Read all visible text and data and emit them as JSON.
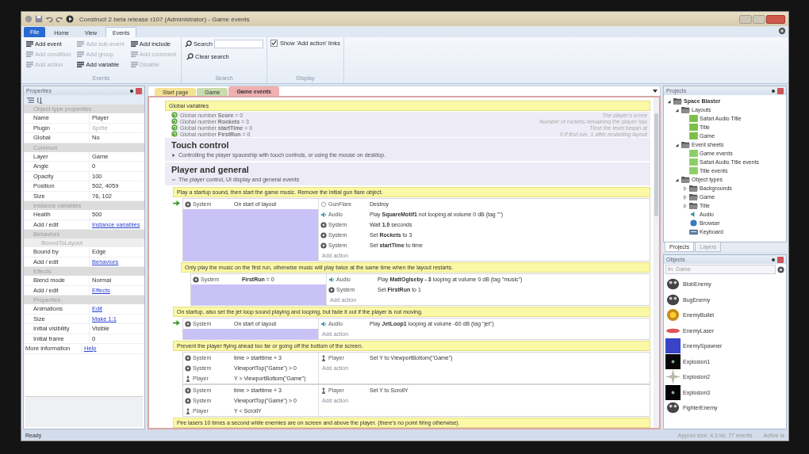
{
  "window": {
    "title": "Construct 2 beta release r107 (Administrator) - Game events"
  },
  "ribbon_tabs": [
    {
      "label": "File",
      "kind": "app"
    },
    {
      "label": "Home",
      "kind": "tab",
      "selected": false
    },
    {
      "label": "View",
      "kind": "tab",
      "selected": false
    },
    {
      "label": "Events",
      "kind": "tab",
      "selected": true
    }
  ],
  "ribbon": {
    "events_group": {
      "label": "Events",
      "buttons": [
        {
          "label": "Add event",
          "disabled": false
        },
        {
          "label": "Add condition",
          "disabled": true
        },
        {
          "label": "Add action",
          "disabled": true
        },
        {
          "label": "Add sub-event",
          "disabled": true
        },
        {
          "label": "Add group",
          "disabled": true
        },
        {
          "label": "Add variable",
          "disabled": false
        },
        {
          "label": "Add include",
          "disabled": false
        },
        {
          "label": "Add comment",
          "disabled": true
        },
        {
          "label": "Disable",
          "disabled": true
        }
      ]
    },
    "search_group": {
      "label": "Search",
      "search_label": "Search",
      "clear": "Clear search"
    },
    "display_group": {
      "label": "Display",
      "checkbox": "Show 'Add action' links",
      "checked": true
    }
  },
  "properties": {
    "title": "Properties",
    "sections": [
      {
        "title": "Object type properties",
        "rows": [
          {
            "name": "Name",
            "value": "Player",
            "kind": "value"
          },
          {
            "name": "Plugin",
            "value": "Sprite",
            "kind": "readonly"
          },
          {
            "name": "Global",
            "value": "No",
            "kind": "value"
          }
        ]
      },
      {
        "title": "Common",
        "rows": [
          {
            "name": "Layer",
            "value": "Game",
            "kind": "value"
          },
          {
            "name": "Angle",
            "value": "0",
            "kind": "value"
          },
          {
            "name": "Opacity",
            "value": "100",
            "kind": "value"
          },
          {
            "name": "Position",
            "value": "502, 4059",
            "kind": "value"
          },
          {
            "name": "Size",
            "value": "76, 102",
            "kind": "value"
          }
        ]
      },
      {
        "title": "Instance variables",
        "rows": [
          {
            "name": "Health",
            "value": "500",
            "kind": "value"
          },
          {
            "name": "Add / edit",
            "value": "Instance variables",
            "kind": "link"
          }
        ]
      },
      {
        "title": "Behaviors",
        "rows": [
          {
            "name": "BoundToLayout",
            "kind": "subheading"
          },
          {
            "name": "Bound by",
            "value": "Edge",
            "kind": "value"
          },
          {
            "name": "Add / edit",
            "value": "Behaviors",
            "kind": "link"
          }
        ]
      },
      {
        "title": "Effects",
        "rows": [
          {
            "name": "Blend mode",
            "value": "Normal",
            "kind": "value"
          },
          {
            "name": "Add / edit",
            "value": "Effects",
            "kind": "link"
          }
        ]
      },
      {
        "title": "Properties",
        "rows": [
          {
            "name": "Animations",
            "value": "Edit",
            "kind": "link"
          },
          {
            "name": "Size",
            "value": "Make 1:1",
            "kind": "link"
          },
          {
            "name": "Initial visibility",
            "value": "Visible",
            "kind": "value"
          },
          {
            "name": "Initial frame",
            "value": "0",
            "kind": "value"
          }
        ]
      }
    ],
    "footer_row": {
      "name": "More information",
      "value": "Help"
    }
  },
  "document_tabs": [
    {
      "label": "Start page",
      "color": "#f5e394",
      "selected": false
    },
    {
      "label": "Game",
      "color": "#c8dcae",
      "selected": false
    },
    {
      "label": "Game events",
      "color": "#f0b0b0",
      "selected": true
    }
  ],
  "event_sheet": {
    "events": [
      {
        "kind": "comment",
        "text": "Global variables"
      },
      {
        "kind": "variable",
        "text": "Global number **Score** = 0",
        "comment": "The player's score"
      },
      {
        "kind": "variable",
        "text": "Global number **Rockets** = 3",
        "comment": "Number of rockets remaining the player has"
      },
      {
        "kind": "variable",
        "text": "Global number **startTime** = 0",
        "comment": "Time the level began at"
      },
      {
        "kind": "variable",
        "text": "Global number **FirstRun** = 0",
        "comment": "0 if first run, 1 after restarting layout"
      },
      {
        "kind": "group",
        "title": "Touch control",
        "description": "Controlling the player spaceship with touch controls, or using the mouse on desktop.",
        "expanded": false
      },
      {
        "kind": "group",
        "title": "Player and general",
        "description": "The player control, UI display and general events",
        "expanded": true,
        "children": [
          {
            "kind": "comment",
            "text": "Play a startup sound, then start the game music.  Remove the initial gun flare object."
          },
          {
            "kind": "event",
            "trigger": true,
            "selected": true,
            "conditions": [
              {
                "kind": "system",
                "object": "System",
                "text": "On start of layout"
              }
            ],
            "actions": [
              {
                "kind": "flare",
                "object": "GunFlare",
                "text": "Destroy"
              },
              {
                "kind": "audio",
                "object": "Audio",
                "text": "Play **SquareMotif1** not looping at volume 0 dB (tag \"\")"
              },
              {
                "kind": "system",
                "object": "System",
                "text": "Wait **1.0** seconds"
              },
              {
                "kind": "system",
                "object": "System",
                "text": "Set **Rockets** to 3"
              },
              {
                "kind": "system",
                "object": "System",
                "text": "Set **startTime** to time"
              }
            ],
            "add_action": "Add action",
            "children": [
              {
                "kind": "comment",
                "text": "Only play the music on the first run, otherwise music will play twice at the same time when the layout restarts."
              },
              {
                "kind": "event",
                "trigger": false,
                "selected": true,
                "conditions": [
                  {
                    "kind": "system",
                    "object": "System",
                    "text": "**FirstRun** = 0"
                  }
                ],
                "actions": [
                  {
                    "kind": "audio",
                    "object": "Audio",
                    "text": "Play **MattOglseby - 3** looping at volume 0 dB (tag \"music\")"
                  },
                  {
                    "kind": "system",
                    "object": "System",
                    "text": "Set **FirstRun** to 1"
                  }
                ],
                "add_action": "Add action"
              }
            ]
          },
          {
            "kind": "comment",
            "text": "On startup, also set the jet loop sound playing and looping, but fade it out if the player is not moving."
          },
          {
            "kind": "event",
            "trigger": true,
            "selected": true,
            "conditions": [
              {
                "kind": "system",
                "object": "System",
                "text": "On start of layout"
              }
            ],
            "actions": [
              {
                "kind": "audio",
                "object": "Audio",
                "text": "Play **JetLoop1** looping at volume -60 dB (tag \"jet\")"
              }
            ],
            "add_action": "Add action"
          },
          {
            "kind": "comment",
            "text": "Prevent the player flying ahead too far or going off the bottom of the screen."
          },
          {
            "kind": "event",
            "trigger": false,
            "selected": false,
            "conditions": [
              {
                "kind": "system",
                "object": "System",
                "text": "time > starttime + 3"
              },
              {
                "kind": "system",
                "object": "System",
                "text": "ViewportTop(\"Game\") > 0"
              },
              {
                "kind": "sprite",
                "object": "Player",
                "text": "Y > ViewportBottom(\"Game\")"
              }
            ],
            "actions": [
              {
                "kind": "sprite",
                "object": "Player",
                "text": "Set Y to ViewportBottom(\"Game\")"
              }
            ],
            "add_action": "Add action"
          },
          {
            "kind": "event",
            "trigger": false,
            "selected": false,
            "conditions": [
              {
                "kind": "system",
                "object": "System",
                "text": "time > starttime + 3"
              },
              {
                "kind": "system",
                "object": "System",
                "text": "ViewportTop(\"Game\") > 0"
              },
              {
                "kind": "sprite",
                "object": "Player",
                "text": "Y < ScrollY"
              }
            ],
            "actions": [
              {
                "kind": "sprite",
                "object": "Player",
                "text": "Set Y to ScrollY"
              }
            ],
            "add_action": "Add action"
          },
          {
            "kind": "comment",
            "text": "Fire lasers 10 times a second while enemies are on screen and above the player. (there's no point firing otherwise)."
          }
        ]
      }
    ]
  },
  "projects": {
    "title": "Projects",
    "tree": [
      {
        "label": "Space Blaster",
        "kind": "project",
        "expanded": true,
        "children": [
          {
            "label": "Layouts",
            "kind": "folder",
            "expanded": true,
            "children": [
              {
                "label": "Safari Audio Title",
                "kind": "layout"
              },
              {
                "label": "Title",
                "kind": "layout"
              },
              {
                "label": "Game",
                "kind": "layout"
              }
            ]
          },
          {
            "label": "Event sheets",
            "kind": "folder",
            "expanded": true,
            "children": [
              {
                "label": "Game events",
                "kind": "sheet"
              },
              {
                "label": "Safari Audio Title events",
                "kind": "sheet"
              },
              {
                "label": "Title events",
                "kind": "sheet"
              }
            ]
          },
          {
            "label": "Object types",
            "kind": "folder",
            "expanded": true,
            "children": [
              {
                "label": "Backgrounds",
                "kind": "folder",
                "expanded": false
              },
              {
                "label": "Game",
                "kind": "folder",
                "expanded": false
              },
              {
                "label": "Title",
                "kind": "folder",
                "expanded": false
              },
              {
                "label": "Audio",
                "kind": "audio"
              },
              {
                "label": "Browser",
                "kind": "browser"
              },
              {
                "label": "Keyboard",
                "kind": "keyboard"
              }
            ]
          }
        ]
      }
    ],
    "tabs": [
      {
        "label": "Projects",
        "selected": true
      },
      {
        "label": "Layers",
        "selected": false
      }
    ]
  },
  "objects": {
    "title": "Objects",
    "filter": "In: Game",
    "items": [
      {
        "label": "BlobEnemy",
        "kind": "creature"
      },
      {
        "label": "BugEnemy",
        "kind": "creature"
      },
      {
        "label": "EnemyBullet",
        "kind": "orb"
      },
      {
        "label": "EnemyLaser",
        "kind": "laser"
      },
      {
        "label": "EnemySpawner",
        "kind": "blue"
      },
      {
        "label": "Explosion1",
        "kind": "dark"
      },
      {
        "label": "Explosion2",
        "kind": "spark"
      },
      {
        "label": "Explosion3",
        "kind": "dark"
      },
      {
        "label": "FighterEnemy",
        "kind": "creature"
      }
    ]
  },
  "status_bar": {
    "left": "Ready",
    "size": "Approx size: 4.3 kb, 77 events",
    "layer": "Active la"
  }
}
